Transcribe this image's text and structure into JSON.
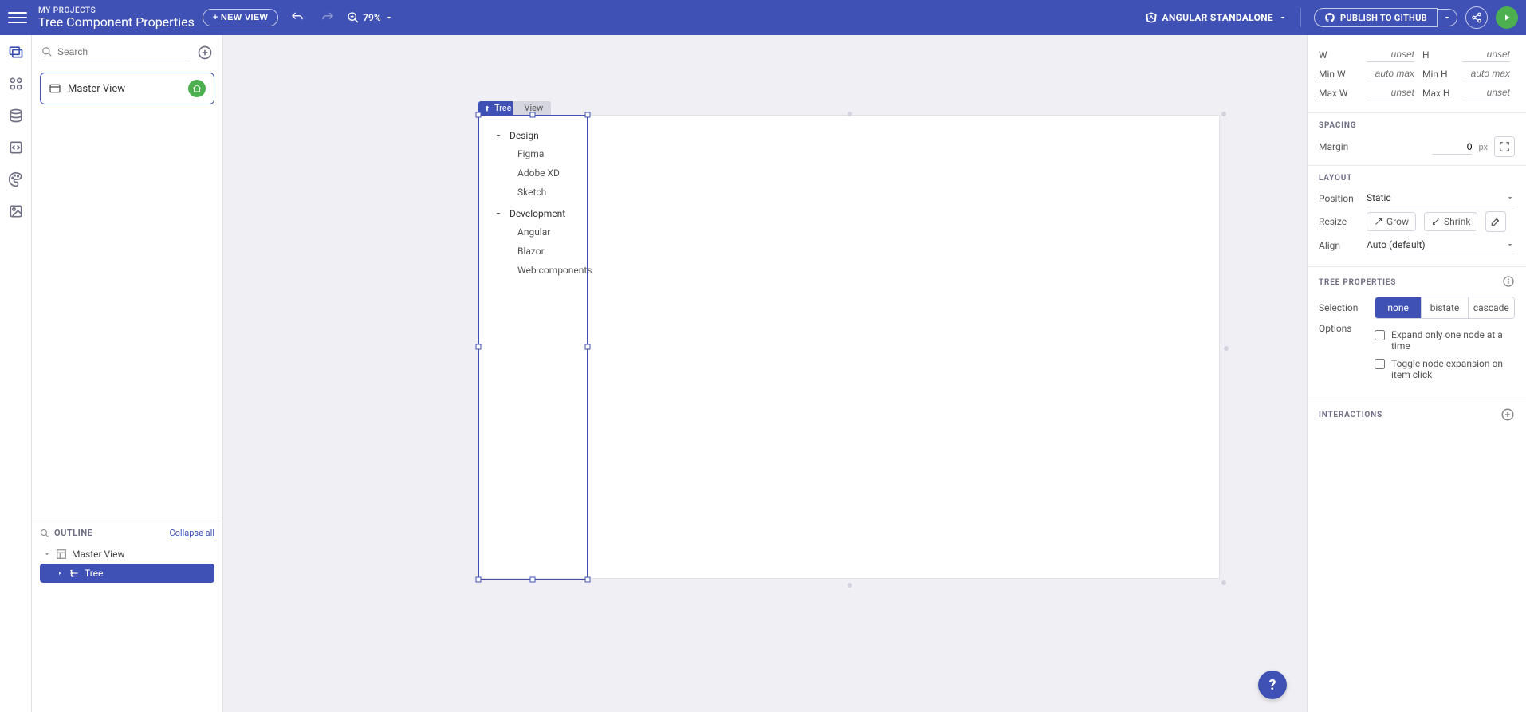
{
  "header": {
    "breadcrumb": "MY PROJECTS",
    "title": "Tree Component Properties",
    "new_view": "+ NEW VIEW",
    "zoom": "79%",
    "framework": "ANGULAR STANDALONE",
    "publish": "PUBLISH TO GITHUB"
  },
  "left": {
    "search_placeholder": "Search",
    "view_name": "Master View",
    "outline_title": "OUTLINE",
    "collapse_all": "Collapse all",
    "outline_root": "Master View",
    "outline_child": "Tree"
  },
  "canvas": {
    "sel_label": "Tree",
    "view_label": "View",
    "tree": {
      "group1": "Design",
      "g1_items": [
        "Figma",
        "Adobe XD",
        "Sketch"
      ],
      "group2": "Development",
      "g2_items": [
        "Angular",
        "Blazor",
        "Web components"
      ]
    }
  },
  "props": {
    "w_label": "W",
    "w_val": "unset",
    "h_label": "H",
    "h_val": "unset",
    "minw_label": "Min W",
    "minw_val": "auto max",
    "minh_label": "Min H",
    "minh_val": "auto max",
    "maxw_label": "Max W",
    "maxw_val": "unset",
    "maxh_label": "Max H",
    "maxh_val": "unset",
    "spacing_title": "SPACING",
    "margin_label": "Margin",
    "margin_val": "0",
    "margin_unit": "px",
    "layout_title": "LAYOUT",
    "position_label": "Position",
    "position_val": "Static",
    "resize_label": "Resize",
    "grow": "Grow",
    "shrink": "Shrink",
    "align_label": "Align",
    "align_val": "Auto (default)",
    "tree_title": "TREE PROPERTIES",
    "selection_label": "Selection",
    "sel_none": "none",
    "sel_bistate": "bistate",
    "sel_cascade": "cascade",
    "options_label": "Options",
    "opt1": "Expand only one node at a time",
    "opt2": "Toggle node expansion on item click",
    "interactions_title": "INTERACTIONS"
  },
  "fab": "?"
}
